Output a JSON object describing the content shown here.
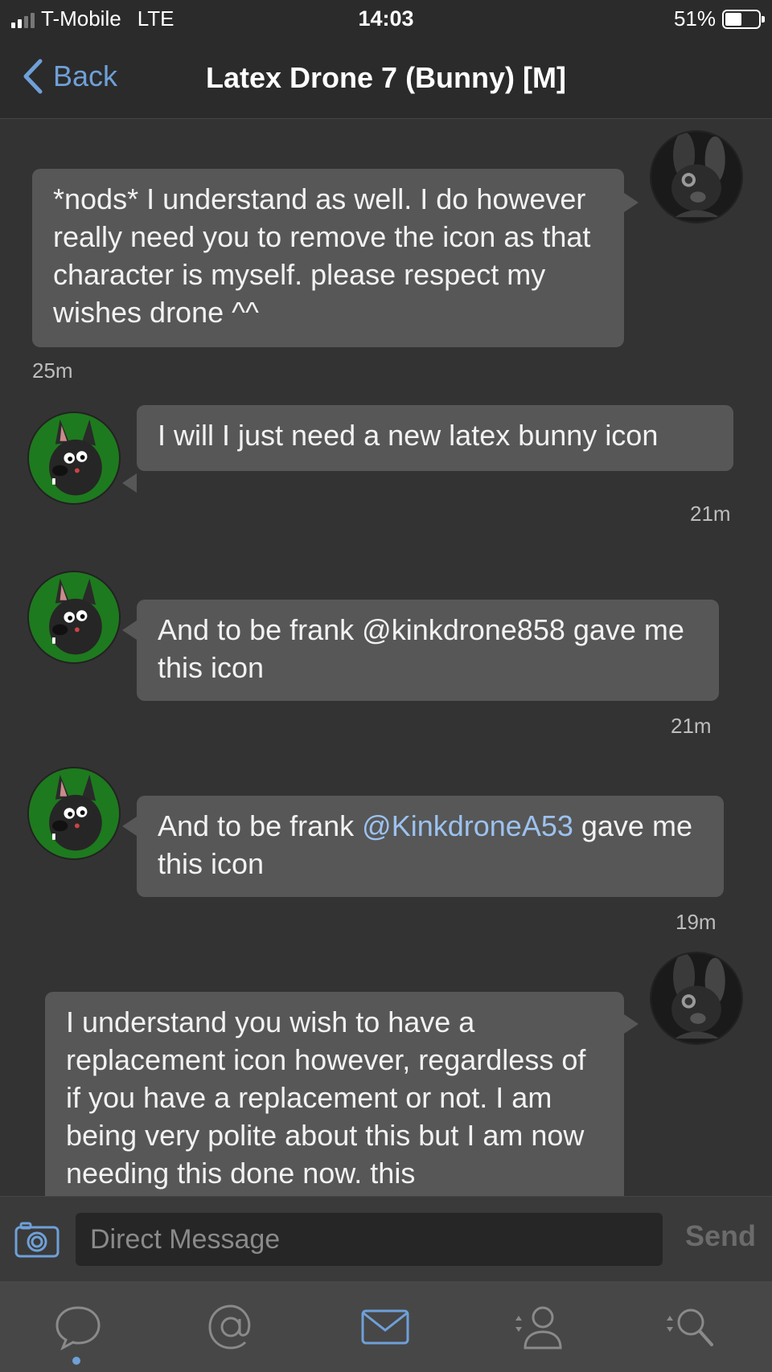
{
  "status_bar": {
    "carrier": "T-Mobile",
    "network": "LTE",
    "time": "14:03",
    "battery_percent": "51%",
    "battery_level": 0.51
  },
  "nav": {
    "back_label": "Back",
    "title": "Latex Drone 7 (Bunny) [M]"
  },
  "messages": [
    {
      "side": "received",
      "text": "*nods* I understand as well. I do however really need you to remove the icon as that character is myself. please respect my wishes drone ^^",
      "time": "25m"
    },
    {
      "side": "sent",
      "text": "I will I just need a new latex bunny icon",
      "time": "21m"
    },
    {
      "side": "sent",
      "text": "And to be frank @kinkdrone858 gave me this icon",
      "time": "21m"
    },
    {
      "side": "sent",
      "text_before": "And to be frank ",
      "mention": "@KinkdroneA53",
      "text_after": " gave me this icon",
      "time": "19m"
    },
    {
      "side": "received",
      "text": "I understand you wish to have a replacement icon however, regardless of if you have a replacement or not. I am being very polite about this but I am now needing this done now. this"
    }
  ],
  "composer": {
    "placeholder": "Direct Message",
    "send_label": "Send"
  },
  "tabs": [
    {
      "name": "tab-conversations",
      "icon": "speech-bubble-icon",
      "active": true
    },
    {
      "name": "tab-mentions",
      "icon": "at-sign-icon"
    },
    {
      "name": "tab-messages",
      "icon": "envelope-icon"
    },
    {
      "name": "tab-profile",
      "icon": "person-icon"
    },
    {
      "name": "tab-search",
      "icon": "magnifier-icon"
    }
  ],
  "colors": {
    "background": "#333333",
    "bubble": "#575757",
    "accent": "#6fa0d8",
    "mention": "#9cc2ef"
  }
}
